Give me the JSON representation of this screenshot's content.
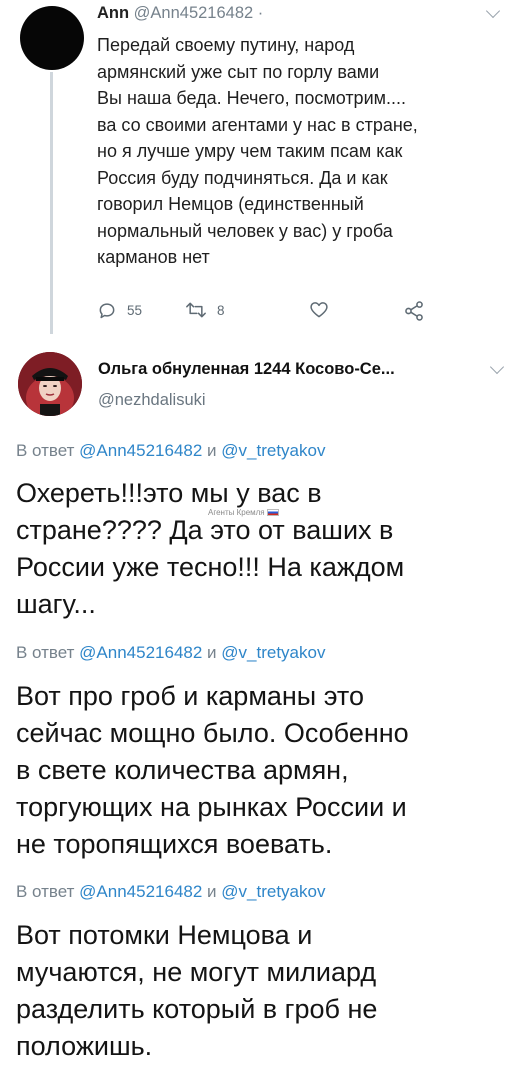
{
  "tweet1": {
    "name": "Ann",
    "handle": "@Ann45216482 ·",
    "text": "Передай своему путину, народ\nармянский уже сыт по горлу вами\n Вы наша беда. Нечего, посмотрим....\nва со своими агентами у нас в стране,\nно я лучше умру чем таким псам как\nРоссия буду подчиняться. Да и как\nговорил Немцов (единственный\nнормальный человек у вас) у гроба\nкарманов нет",
    "replies": "55",
    "retweets": "8"
  },
  "tweet2": {
    "name": "Ольга обнуленная 1244 Косово-Се...",
    "handle": "@nezhdalisuki",
    "messages": [
      {
        "reply_prefix": "В ответ ",
        "reply_user1": "@Ann45216482",
        "reply_and": " и ",
        "reply_user2": "@v_tretyakov",
        "text": "Охереть!!!это мы у вас в\nстране???? Да это от ваших в\nРоссии уже тесно!!! На каждом\nшагу..."
      },
      {
        "reply_prefix": "В ответ ",
        "reply_user1": "@Ann45216482",
        "reply_and": " и ",
        "reply_user2": "@v_tretyakov",
        "text": "Вот про гроб и карманы это\nсейчас мощно было. Особенно\nв свете количества армян,\nторгующих на рынках России и\nне торопящихся воевать."
      },
      {
        "reply_prefix": "В ответ ",
        "reply_user1": "@Ann45216482",
        "reply_and": " и ",
        "reply_user2": "@v_tretyakov",
        "text": "Вот потомки Немцова и\nмучаются, не могут милиард\nразделить который в гроб не\nположишь."
      }
    ]
  },
  "watermark": "Агенты Кремля",
  "icons": [
    "chevron-down-icon",
    "reply-icon",
    "retweet-icon",
    "like-icon",
    "share-icon"
  ],
  "colors": {
    "link": "#2f86c9",
    "muted": "#76828c",
    "text": "#141414"
  }
}
